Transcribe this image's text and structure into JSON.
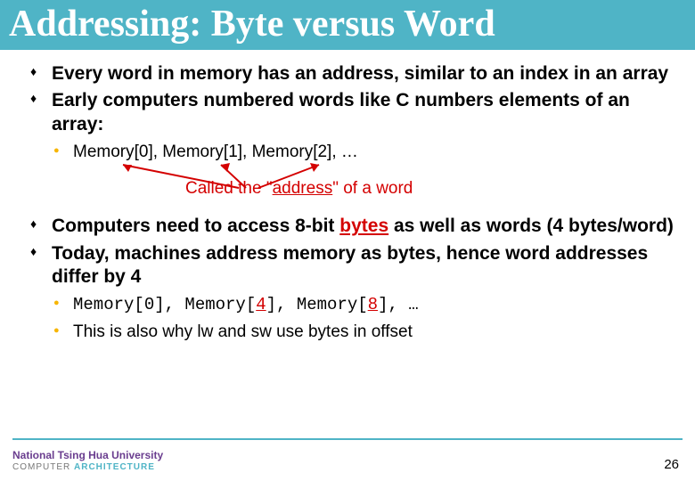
{
  "title": "Addressing: Byte versus Word",
  "bullets1": {
    "b1": "Every word in memory has an address, similar to an index in an array",
    "b2": "Early computers numbered words like C numbers elements of an array:",
    "sub1": "Memory[0], Memory[1], Memory[2],  …"
  },
  "address_note_pre": "Called the \"",
  "address_note_word": "address",
  "address_note_post": "\" of a word",
  "bullets2": {
    "b1_pre": "Computers need to access 8-bit ",
    "b1_bytes": "bytes",
    "b1_post": " as well as words (4 bytes/word)",
    "b2": "Today, machines address memory as bytes, hence word addresses differ by 4",
    "sub1_a": "Memory[0], Memory[",
    "sub1_4": "4",
    "sub1_b": "], Memory[",
    "sub1_8": "8",
    "sub1_c": "], …",
    "sub2": "This is also why lw and sw use bytes in offset"
  },
  "footer": {
    "uni": "National Tsing Hua University",
    "dept_a": "COMPUTER ",
    "dept_b": "ARCHITECTURE"
  },
  "page": "26"
}
